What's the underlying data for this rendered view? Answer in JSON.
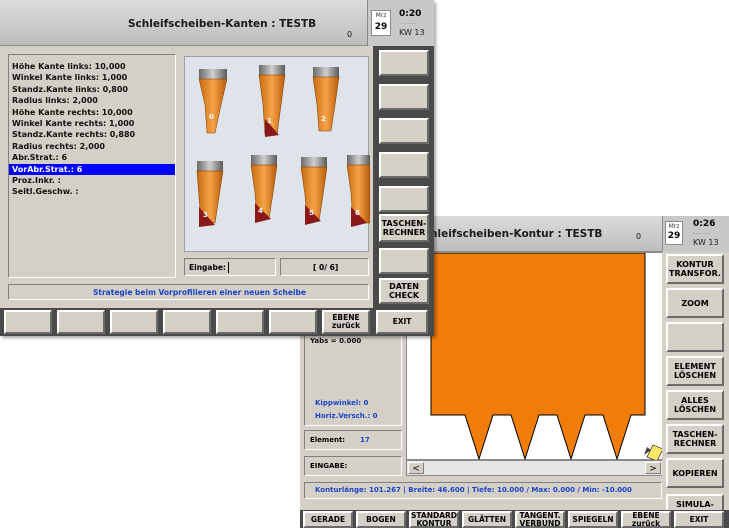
{
  "window1": {
    "title": "Schleifscheiben-Kanten : TESTB",
    "title_counter": "0",
    "time": "0:20",
    "month": "Mrz",
    "day": "29",
    "week": "KW 13",
    "params": [
      "Höhe Kante links: 10,000",
      "Winkel Kante links: 1,000",
      "Standz.Kante links: 0,800",
      "Radius links: 2,000",
      "Höhe Kante rechts: 10,000",
      "Winkel Kante rechts: 1,000",
      "Standz.Kante rechts: 0,880",
      "Radius rechts: 2,000",
      "Abr.Strat.: 6",
      "VorAbr.Strat.: 6",
      "Proz.Inkr. :",
      "Seitl.Geschw. :"
    ],
    "selected_param_index": 9,
    "wheel_labels": [
      "0",
      "1",
      "2",
      "3",
      "4",
      "5",
      "6"
    ],
    "eingabe_label": "Eingabe:",
    "page_indicator": "[ 0/ 6]",
    "status_text": "Strategie beim Vorprofilieren einer neuen Scheibe",
    "side_buttons": [
      "",
      "",
      "",
      "",
      "",
      "TASCHEN-\nRECHNER",
      "",
      "DATEN\nCHECK"
    ],
    "bottom_buttons": [
      "",
      "",
      "",
      "",
      "",
      "",
      "EBENE\nzurück",
      "EXIT"
    ]
  },
  "window2": {
    "title": "hleifscheiben-Kontur : TESTB",
    "title_counter": "0",
    "time": "0:26",
    "month": "Mrz",
    "day": "29",
    "week": "KW 13",
    "yabs": "Yabs = 0.000",
    "kippwinkel": "Kippwinkel:  0",
    "horiz_versch": "Horiz.Versch.:  0",
    "element_label": "Element:",
    "element_value": "17",
    "eingabe_label": "EINGABE:",
    "scroll_left": "<",
    "scroll_right": ">",
    "status_text": "Konturlänge: 101.267  |  Breite: 46.600  |  Tiefe: 10.000  /  Max: 0.000  /  Min: -10.000",
    "side_buttons": [
      "KONTUR\nTRANSFOR.",
      "ZOOM",
      "",
      "ELEMENT\nLÖSCHEN",
      "ALLES\nLÖSCHEN",
      "TASCHEN-\nRECHNER",
      "KOPIEREN",
      "SIMULA-\nTION"
    ],
    "bottom_buttons": [
      "GERADE",
      "BOGEN",
      "STANDARD\nKONTUR",
      "GLÄTTEN",
      "TANGENT.\nVERBUND",
      "SPIEGELN",
      "EBENE\nzurück",
      "EXIT"
    ]
  },
  "colors": {
    "panel": "#d4d0c8",
    "title_bar": "#c8c8c8",
    "contour_orange": "#f07d0a",
    "selection_blue": "#0000ff",
    "status_blue": "#1a44c8",
    "dark_frame": "#4a4a4a"
  },
  "icons": {
    "scroll_left": "chevron-left-icon",
    "scroll_right": "chevron-right-icon",
    "tool_cursor": "pencil-icon",
    "calendar": "calendar-icon"
  }
}
